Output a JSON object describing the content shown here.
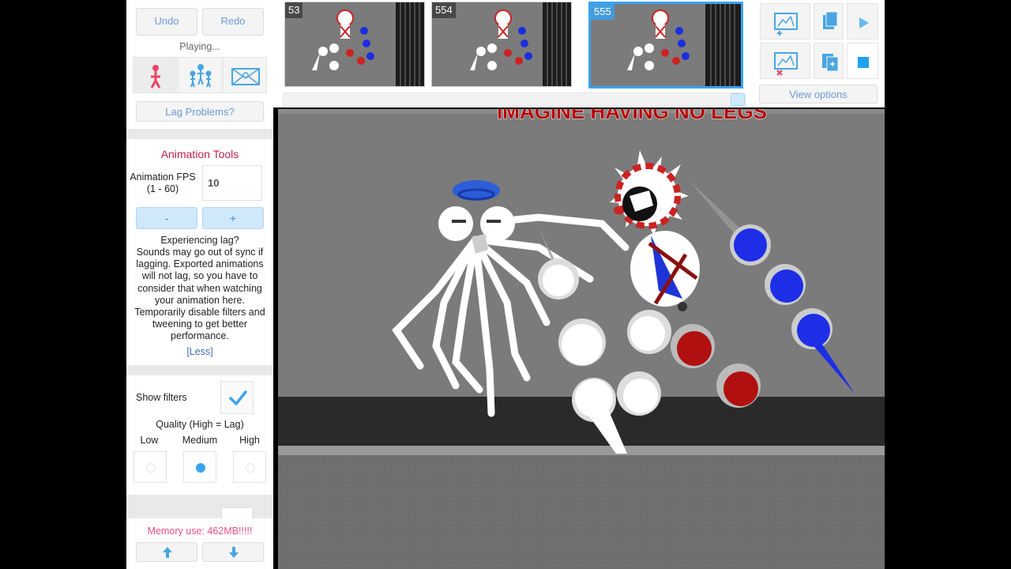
{
  "left_panel": {
    "undo_label": "Undo",
    "redo_label": "Redo",
    "status_text": "Playing...",
    "modes": [
      {
        "icon": "stick-figure-icon"
      },
      {
        "icon": "group-figures-icon"
      },
      {
        "icon": "scene-icon"
      }
    ],
    "lag_problems_label": "Lag Problems?",
    "animation_tools_title": "Animation Tools",
    "fps_label_line1": "Animation FPS",
    "fps_label_line2": "(1 - 60)",
    "fps_value": "10",
    "minus_label": "-",
    "plus_label": "+",
    "lag_heading": "Experiencing lag?",
    "lag_text": "Sounds may go out of sync if lagging. Exported animations will not lag, so you have to consider that when watching your animation here. Temporarily disable filters and tweening to get better performance.",
    "less_link": "[Less]",
    "show_filters_label": "Show filters",
    "show_filters_checked": true,
    "quality_title": "Quality (High = Lag)",
    "quality_options": [
      "Low",
      "Medium",
      "High"
    ],
    "quality_selected": "Medium",
    "memory_text": "Memory use: 462MB!!!!!",
    "move_up_icon": "arrow-up-icon",
    "move_down_icon": "arrow-down-icon"
  },
  "frames": [
    {
      "number": "53"
    },
    {
      "number": "554"
    },
    {
      "number": "555",
      "selected": true
    }
  ],
  "right_panel": {
    "add_frame_icon": "add-frame-icon",
    "copy_frame_icon": "copy-frame-icon",
    "play_icon": "play-icon",
    "delete_frame_icon": "delete-frame-icon",
    "paste_frame_icon": "paste-frame-icon",
    "stop_icon": "stop-icon",
    "view_options_label": "View options"
  },
  "canvas": {
    "banner_text": "IMAGINE HAVING NO LEGS"
  },
  "colors": {
    "accent_blue": "#3aa3f0",
    "link_blue": "#6b9bd2",
    "title_red": "#c0204a",
    "memory_pink": "#e0508a"
  }
}
